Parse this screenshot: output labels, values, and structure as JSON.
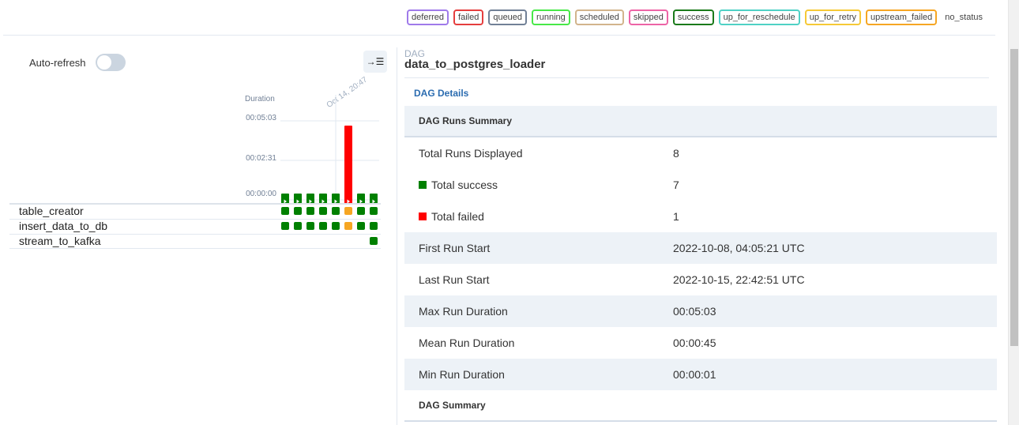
{
  "legend": {
    "items": [
      {
        "label": "deferred",
        "color": "#9f7aea"
      },
      {
        "label": "failed",
        "color": "#e53e3e"
      },
      {
        "label": "queued",
        "color": "#718096"
      },
      {
        "label": "running",
        "color": "#48e848"
      },
      {
        "label": "scheduled",
        "color": "#d2b48c"
      },
      {
        "label": "skipped",
        "color": "#ed64a6"
      },
      {
        "label": "success",
        "color": "#1a7a1a"
      },
      {
        "label": "up_for_reschedule",
        "color": "#4fd1c5"
      },
      {
        "label": "up_for_retry",
        "color": "#f6c936"
      },
      {
        "label": "upstream_failed",
        "color": "#f6a623"
      }
    ],
    "no_status": "no_status"
  },
  "left": {
    "autorefresh_label": "Auto-refresh",
    "collapse_icon": "collapse-right-icon",
    "duration_label": "Duration",
    "ticks": [
      "00:05:03",
      "00:02:31",
      "00:00:00"
    ],
    "run_date": "Oct 14, 20:47"
  },
  "chart_data": {
    "type": "bar",
    "ylabel": "Duration",
    "y_ticks": [
      "00:00:00",
      "00:02:31",
      "00:05:03"
    ],
    "runs": [
      {
        "state": "success",
        "duration_s": 4
      },
      {
        "state": "success",
        "duration_s": 2
      },
      {
        "state": "success",
        "duration_s": 2
      },
      {
        "state": "success",
        "duration_s": 2
      },
      {
        "state": "success",
        "duration_s": 2
      },
      {
        "state": "failed",
        "duration_s": 303
      },
      {
        "state": "success",
        "duration_s": 2
      },
      {
        "state": "success",
        "duration_s": 2
      }
    ],
    "ylim": [
      0,
      303
    ]
  },
  "tasks": [
    {
      "name": "table_creator",
      "states": [
        "success",
        "success",
        "success",
        "success",
        "success",
        "upstream_failed",
        "success",
        "success"
      ]
    },
    {
      "name": "insert_data_to_db",
      "states": [
        "success",
        "success",
        "success",
        "success",
        "success",
        "upstream_failed",
        "success",
        "success"
      ]
    },
    {
      "name": "stream_to_kafka",
      "states": [
        "",
        "",
        "",
        "",
        "",
        "",
        "",
        "success"
      ]
    }
  ],
  "dag": {
    "breadcrumb_label": "DAG",
    "title": "data_to_postgres_loader",
    "tab": "DAG Details",
    "runs_summary_header": "DAG Runs Summary",
    "rows": [
      {
        "key": "Total Runs Displayed",
        "value": "8",
        "marker": ""
      },
      {
        "key": "Total success",
        "value": "7",
        "marker": "#008000"
      },
      {
        "key": "Total failed",
        "value": "1",
        "marker": "#ff0000"
      },
      {
        "key": "First Run Start",
        "value": "2022-10-08, 04:05:21 UTC",
        "marker": ""
      },
      {
        "key": "Last Run Start",
        "value": "2022-10-15, 22:42:51 UTC",
        "marker": ""
      },
      {
        "key": "Max Run Duration",
        "value": "00:05:03",
        "marker": ""
      },
      {
        "key": "Mean Run Duration",
        "value": "00:00:45",
        "marker": ""
      },
      {
        "key": "Min Run Duration",
        "value": "00:00:01",
        "marker": ""
      }
    ],
    "summary_header": "DAG Summary"
  }
}
